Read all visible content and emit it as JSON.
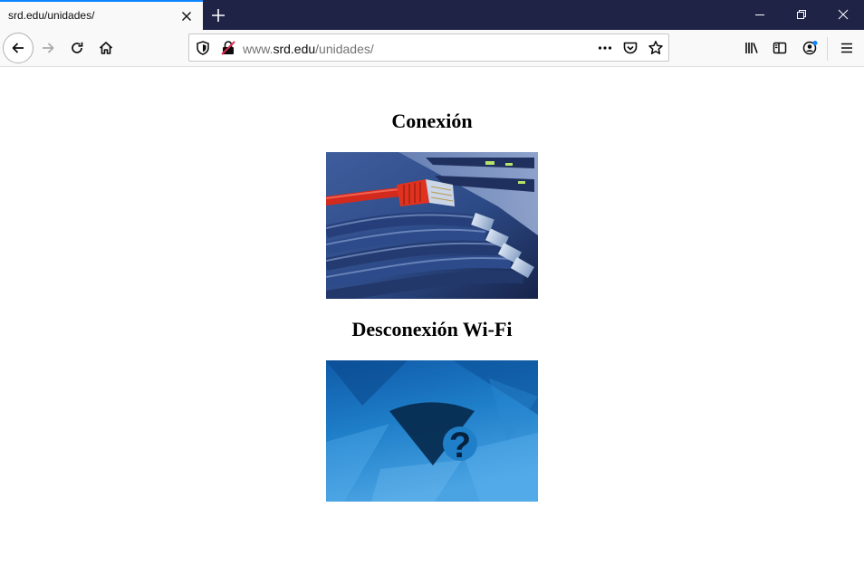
{
  "browser": {
    "tab_title": "srd.edu/unidades/",
    "url": {
      "prefix": "www.",
      "host": "srd.edu",
      "path": "/unidades/"
    },
    "icons": {
      "tab_close": "close-icon",
      "new_tab": "plus-icon",
      "minimize": "minimize-icon",
      "restore": "restore-icon",
      "close": "close-icon",
      "back": "arrow-left-icon",
      "forward": "arrow-right-icon",
      "reload": "reload-icon",
      "home": "home-icon",
      "tracking": "shield-icon",
      "insecure": "insecure-lock-icon",
      "page_actions": "more-dots-icon",
      "pocket": "pocket-icon",
      "bookmark": "star-icon",
      "library": "library-icon",
      "sidebar": "sidebar-icon",
      "account": "account-icon",
      "menu": "hamburger-menu-icon"
    },
    "colors": {
      "tab_strip": "#1f2447",
      "active_tab_accent": "#0a84ff",
      "toolbar": "#f9f9fa",
      "account_badge": "#0a84ff"
    }
  },
  "page": {
    "sections": [
      {
        "heading": "Conexión",
        "image": "ethernet-cable-photo"
      },
      {
        "heading": "Desconexión Wi-Fi",
        "image": "wifi-question-photo"
      }
    ]
  }
}
